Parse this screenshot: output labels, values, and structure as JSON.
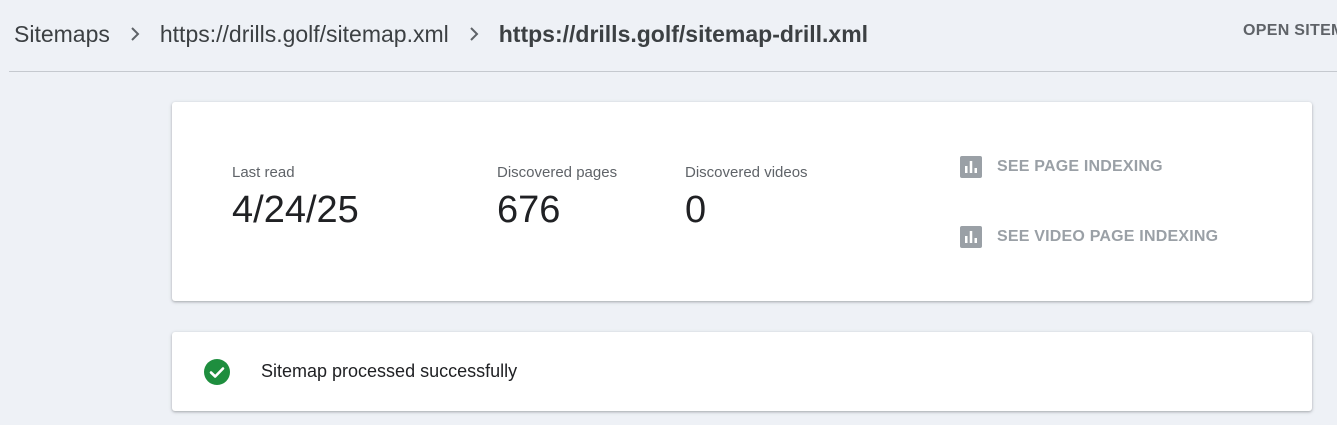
{
  "breadcrumb": {
    "items": [
      {
        "label": "Sitemaps"
      },
      {
        "label": "https://drills.golf/sitemap.xml"
      },
      {
        "label": "https://drills.golf/sitemap-drill.xml"
      }
    ],
    "separator_icon": "chevron-right-icon"
  },
  "header": {
    "open_link_label": "OPEN SITEMAP"
  },
  "stats": {
    "last_read": {
      "label": "Last read",
      "value": "4/24/25"
    },
    "discovered_pages": {
      "label": "Discovered pages",
      "value": "676"
    },
    "discovered_videos": {
      "label": "Discovered videos",
      "value": "0"
    }
  },
  "actions": {
    "page_indexing": {
      "label": "SEE PAGE INDEXING",
      "icon": "bar-chart-icon"
    },
    "video_indexing": {
      "label": "SEE VIDEO PAGE INDEXING",
      "icon": "bar-chart-icon"
    }
  },
  "status": {
    "text": "Sitemap processed successfully",
    "icon": "check-circle-icon",
    "color": "#1e8e3e"
  },
  "colors": {
    "background": "#eef1f6",
    "card": "#ffffff",
    "muted_action": "#9aa0a6"
  }
}
